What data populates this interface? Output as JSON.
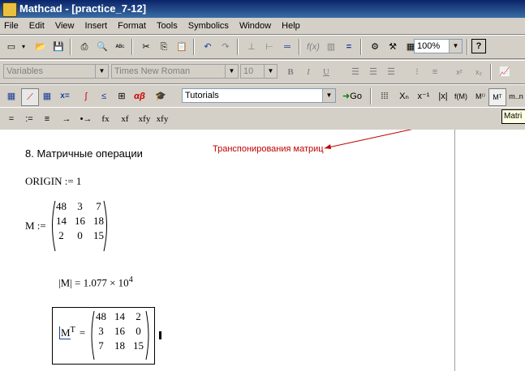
{
  "window": {
    "title": "Mathcad - [practice_7-12]"
  },
  "menu": [
    "File",
    "Edit",
    "View",
    "Insert",
    "Format",
    "Tools",
    "Symbolics",
    "Window",
    "Help"
  ],
  "toolbar1": {
    "zoom": "100%"
  },
  "toolbar2": {
    "style": "Variables",
    "font": "Times New Roman",
    "size": "10"
  },
  "toolbar3": {
    "resources": "Tutorials",
    "go": "Go"
  },
  "toolbar4": {
    "items": [
      "=",
      ":=",
      "≡",
      "→",
      "•→",
      "fx",
      "xf",
      "xfy",
      "xfy"
    ]
  },
  "tooltip": "Matri",
  "worksheet": {
    "heading": "8. Матричные операции",
    "annotation": "Транспонирования матриц",
    "origin": "ORIGIN := 1",
    "m_label": "M :=",
    "matrix_m": [
      [
        "48",
        "3",
        "7"
      ],
      [
        "14",
        "16",
        "18"
      ],
      [
        "2",
        "0",
        "15"
      ]
    ],
    "det_expr": "|M| = 1.077 × 10",
    "det_exp": "4",
    "mt_label": "M",
    "mt_sup": "T",
    "mt_eq": "=",
    "matrix_mt": [
      [
        "48",
        "14",
        "2"
      ],
      [
        "3",
        "16",
        "0"
      ],
      [
        "7",
        "18",
        "15"
      ]
    ]
  }
}
